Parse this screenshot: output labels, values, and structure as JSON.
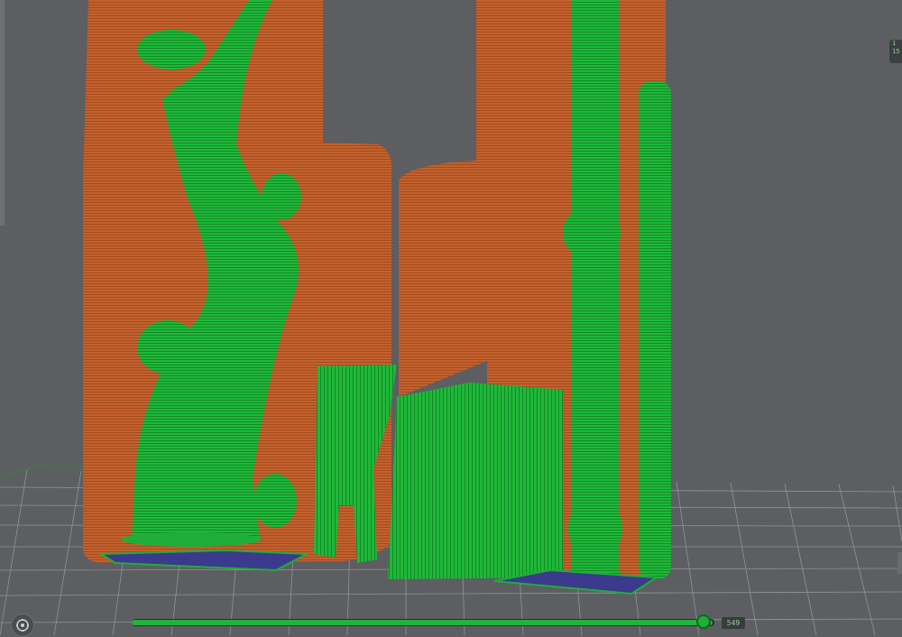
{
  "viewport": {
    "background_color": "#5d5e62",
    "colors": {
      "wall": "#c4612c",
      "support": "#1fae3a",
      "first_layer": "#3b3a8c",
      "grid": "#9fa1a4"
    }
  },
  "corner_indicator": {
    "line1": "1",
    "line2": "15"
  },
  "layer_slider": {
    "progress": 0.997,
    "value_label": "549"
  },
  "icons": {
    "view_button": "orbit-icon"
  }
}
